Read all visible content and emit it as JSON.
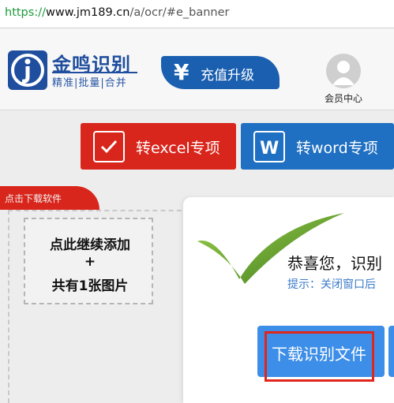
{
  "browser": {
    "url_scheme": "https://",
    "url_host": "www.jm189.cn",
    "url_path": "/a/ocr/#e_banner"
  },
  "header": {
    "logo_title": "金鸣识别",
    "logo_subtitle": "精准|批量|合并",
    "recharge_symbol": "¥",
    "recharge_label": "充值升级",
    "member_label": "会员中心"
  },
  "convert": {
    "excel_label": "转excel专项",
    "word_label": "转word专项"
  },
  "left_panel": {
    "download_tab": "点击下载软件",
    "add_line1": "点此继续添加",
    "add_line2": "+",
    "add_line3": "共有1张图片"
  },
  "modal": {
    "title": "恭喜您，识别",
    "tip": "提示：关闭窗口后",
    "download_button": "下载识别文件"
  },
  "colors": {
    "brand_blue": "#1f4e9e",
    "excel_red": "#d9261c",
    "word_blue": "#1f6fc2",
    "button_blue": "#3d8ee8",
    "highlight_red": "#e0251b"
  }
}
